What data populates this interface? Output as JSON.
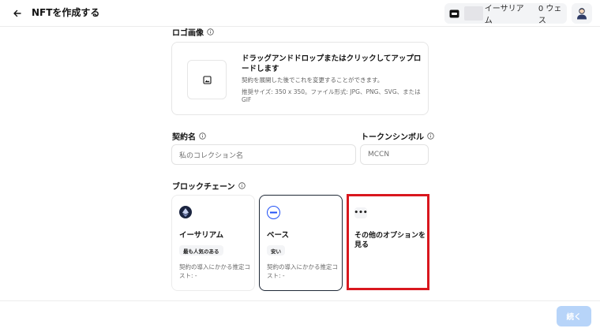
{
  "header": {
    "title": "NFTを作成する",
    "wallet_chain": "イーサリアム",
    "wallet_balance": "0 ウェス"
  },
  "logo_section": {
    "label": "ロゴ画像",
    "upload_title": "ドラッグアンドドロップまたはクリックしてアップロードします",
    "upload_subtitle": "契約を展開した後でこれを変更することができます。",
    "upload_hint": "推奨サイズ: 350 x 350。ファイル形式: JPG、PNG、SVG、または GIF"
  },
  "contract_name": {
    "label": "契約名",
    "placeholder": "私のコレクション名"
  },
  "token_symbol": {
    "label": "トークンシンボル",
    "placeholder": "MCCN"
  },
  "blockchain": {
    "label": "ブロックチェーン",
    "options": [
      {
        "name": "イーサリアム",
        "badge": "最も人気のある",
        "cost": "契約の導入にかかる推定コスト: -",
        "selected": false
      },
      {
        "name": "ベース",
        "badge": "安い",
        "cost": "契約の導入にかかる推定コスト: -",
        "selected": true
      }
    ],
    "more": {
      "dots": "•••",
      "label": "その他のオプションを見る"
    }
  },
  "footer": {
    "continue_label": "続く"
  },
  "colors": {
    "highlight_border": "#d9171e",
    "continue_button_disabled": "#b7d4f9",
    "base_blue": "#2151f5",
    "ethereum_dark": "#1b2540"
  },
  "icons": {
    "back": "arrow-left-icon",
    "wallet": "wallet-icon",
    "avatar": "user-avatar-icon",
    "info": "info-icon",
    "image": "image-icon",
    "ethereum": "ethereum-logo-icon",
    "base": "base-logo-icon"
  }
}
